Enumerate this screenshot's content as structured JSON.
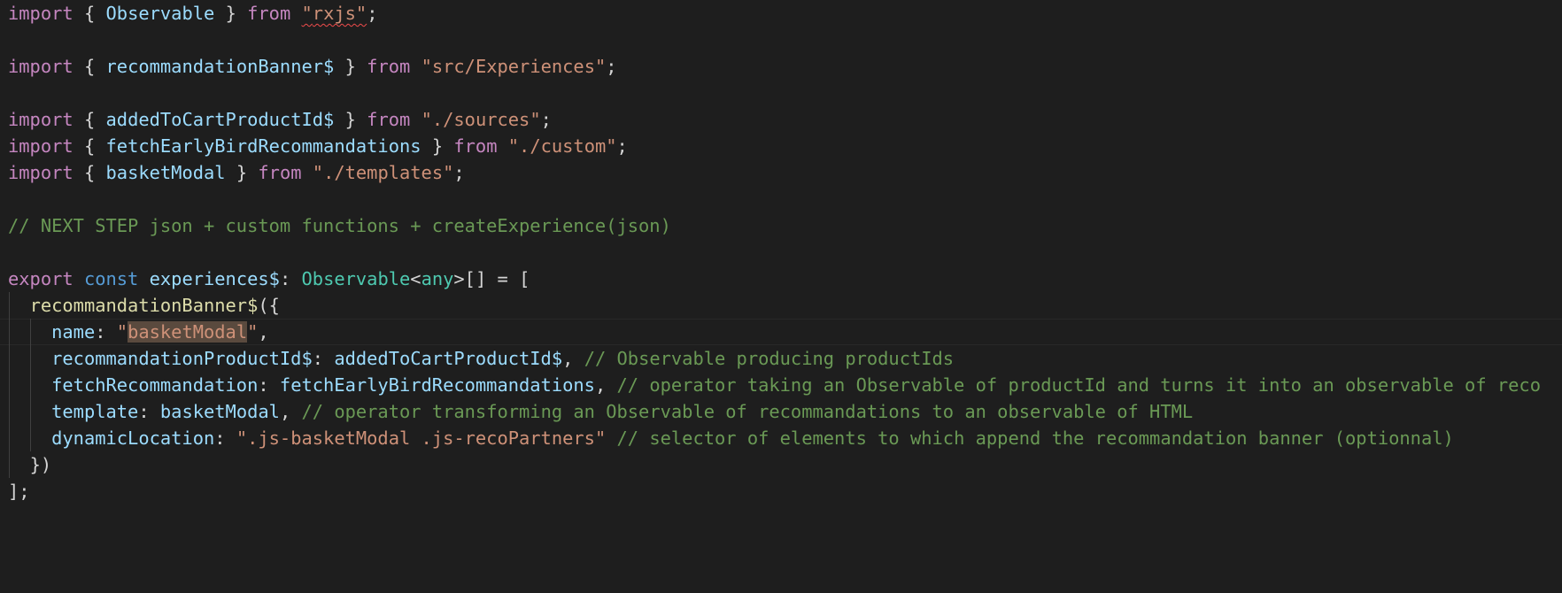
{
  "editor": {
    "language": "typescript",
    "theme_colors": {
      "background": "#1e1e1e",
      "keyword": "#c586c0",
      "declaration": "#569cd6",
      "variable": "#9cdcfe",
      "string": "#ce9178",
      "comment": "#6a9955",
      "type": "#4ec9b0",
      "function": "#dcdcaa",
      "error_squiggle": "#f14c4c"
    },
    "lines": {
      "l1": {
        "import": "import",
        "brace_open": "{",
        "name": "Observable",
        "brace_close": "}",
        "from": "from",
        "q1": "\"",
        "path": "rxjs",
        "q2": "\"",
        "semi": ";"
      },
      "l3": {
        "import": "import",
        "brace_open": "{",
        "name": "recommandationBanner$",
        "brace_close": "}",
        "from": "from",
        "path": "\"src/Experiences\"",
        "semi": ";"
      },
      "l5": {
        "import": "import",
        "brace_open": "{",
        "name": "addedToCartProductId$",
        "brace_close": "}",
        "from": "from",
        "path": "\"./sources\"",
        "semi": ";"
      },
      "l6": {
        "import": "import",
        "brace_open": "{",
        "name": "fetchEarlyBirdRecommandations",
        "brace_close": "}",
        "from": "from",
        "path": "\"./custom\"",
        "semi": ";"
      },
      "l7": {
        "import": "import",
        "brace_open": "{",
        "name": "basketModal",
        "brace_close": "}",
        "from": "from",
        "path": "\"./templates\"",
        "semi": ";"
      },
      "l9": {
        "comment": "// NEXT STEP json + custom functions + createExperience(json)"
      },
      "l11": {
        "export": "export",
        "const": "const",
        "name": "experiences$",
        "colon": ":",
        "type": "Observable",
        "lt": "<",
        "generic": "any",
        "gt_arr": ">[] = ["
      },
      "l12": {
        "fn": "recommandationBanner$",
        "punc": "({"
      },
      "l13": {
        "key": "name",
        "colon": ":",
        "q1": "\"",
        "value": "basketModal",
        "q2": "\"",
        "comma": ","
      },
      "l14": {
        "key": "recommandationProductId$",
        "colon": ":",
        "value": "addedToCartProductId$",
        "comma": ",",
        "comment": "// Observable producing productIds"
      },
      "l15": {
        "key": "fetchRecommandation",
        "colon": ":",
        "value": "fetchEarlyBirdRecommandations",
        "comma": ",",
        "comment": "// operator taking an Observable of productId and turns it into an observable of reco"
      },
      "l16": {
        "key": "template",
        "colon": ":",
        "value": "basketModal",
        "comma": ",",
        "comment": "// operator transforming an Observable of recommandations to an observable of HTML"
      },
      "l17": {
        "key": "dynamicLocation",
        "colon": ":",
        "value": "\".js-basketModal .js-recoPartners\"",
        "comment": "// selector of elements to which append the recommandation banner (optionnal)"
      },
      "l18": {
        "punc": "})"
      },
      "l19": {
        "punc": "];"
      }
    }
  }
}
